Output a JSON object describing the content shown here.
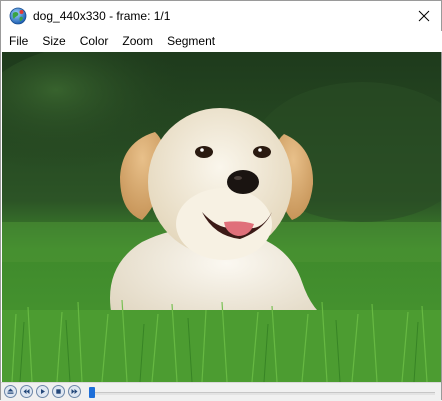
{
  "window": {
    "title": "dog_440x330 - frame: 1/1"
  },
  "menu": {
    "items": [
      "File",
      "Size",
      "Color",
      "Zoom",
      "Segment"
    ]
  },
  "controls": {
    "frame_position": 0,
    "icons": [
      "eject-icon",
      "rewind-icon",
      "play-icon",
      "stop-icon",
      "fast-forward-icon"
    ]
  },
  "colors": {
    "accent": "#1e6fd9",
    "grass": "#3f8f2a",
    "background": "#203a1e"
  }
}
